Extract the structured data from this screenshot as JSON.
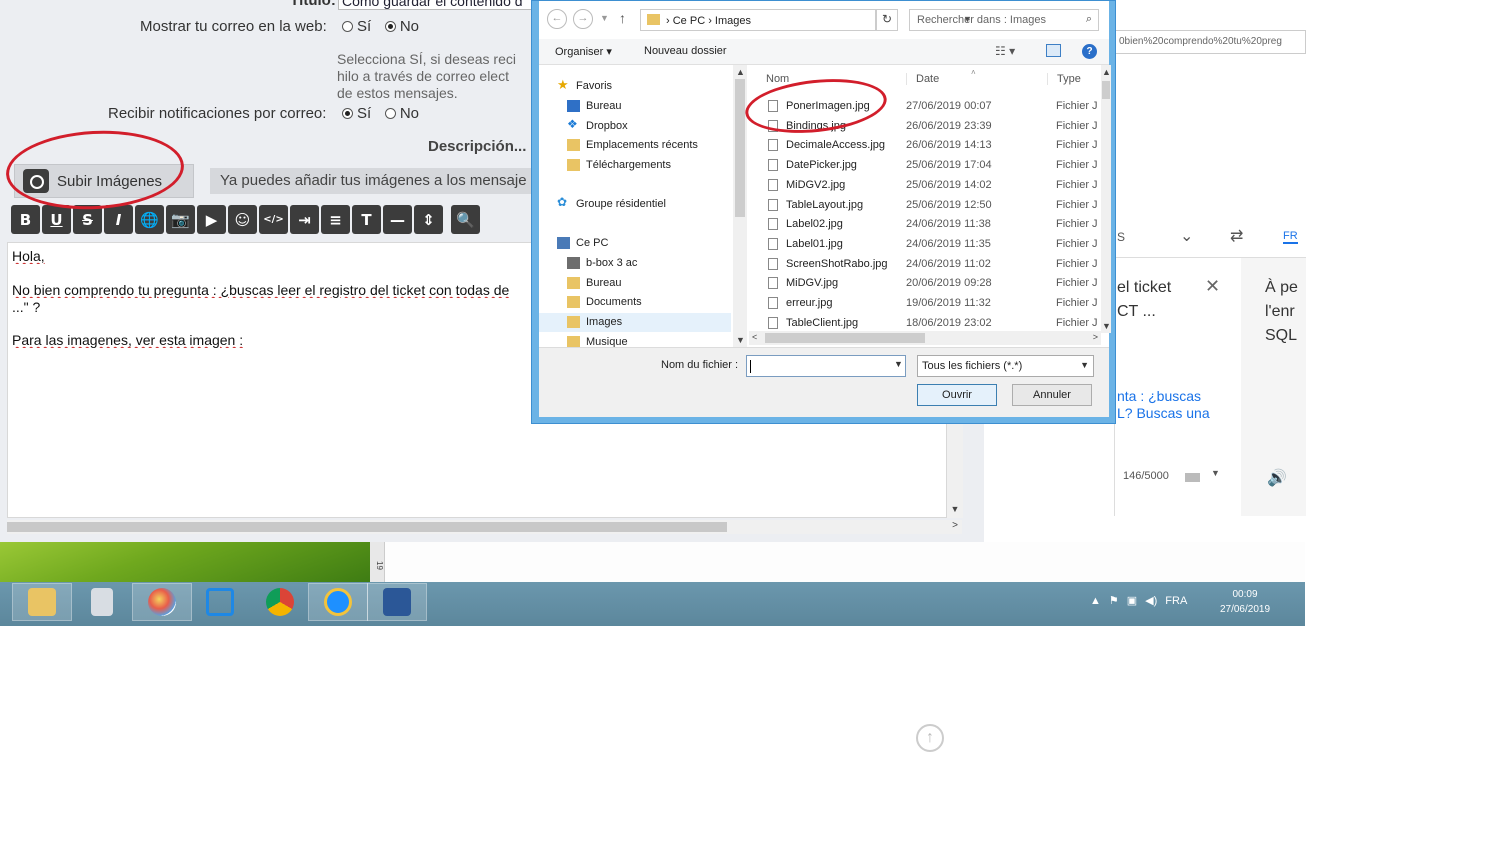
{
  "forum": {
    "titulo_label": "Título:",
    "titulo_value": "Cómo guardar el contenido d",
    "mostrar_label": "Mostrar tu correo en la web:",
    "mostrar_options": [
      "Sí",
      "No"
    ],
    "help_lines": [
      "Selecciona SÍ, si deseas reci",
      "hilo a través de correo elect",
      "de estos mensajes."
    ],
    "recibir_label": "Recibir notificaciones por correo:",
    "recibir_options": [
      "Sí",
      "No"
    ],
    "descripcion": "Descripción...",
    "upload_label": "Subir Imágenes",
    "upload_hint": "Ya puedes añadir tus imágenes a los mensaje",
    "toolbar": [
      "B",
      "U",
      "S",
      "I",
      "🌐",
      "📷",
      "▶",
      "☺",
      "</>",
      "⇥",
      "≡",
      "T",
      "—",
      "⇕",
      "🔍"
    ],
    "editor": {
      "line1": "Hola,",
      "line2": "No bien comprendo tu pregunta : ¿buscas leer el registro del ticket con todas de",
      "line3": "...\" ?",
      "line4": "Para las imagenes, ver esta imagen :"
    }
  },
  "translator": {
    "url": "0bien%20comprendo%20tu%20preg",
    "lang_src": "S",
    "lang_dst": "FR",
    "src_text_1": "el ticket",
    "src_text_2": "CT ...",
    "dst_text_1": "À pe",
    "dst_text_2": "l'enr",
    "dst_text_3": "SQL",
    "link_1": "nta : ¿buscas",
    "link_2": "L? Buscas una",
    "count": "146/5000"
  },
  "desktop": {
    "ruler": "19"
  },
  "taskbar": {
    "apps": [
      "file-explorer",
      "calculator",
      "paint",
      "snipping-tool",
      "chrome",
      "internet-explorer",
      "word"
    ],
    "lang": "FRA",
    "time": "00:09",
    "date": "27/06/2019"
  },
  "dialog": {
    "address_parts": [
      "Ce PC",
      "Images"
    ],
    "search_placeholder": "Rechercher dans : Images",
    "organiser": "Organiser",
    "nouveau_dossier": "Nouveau dossier",
    "nav_items": [
      {
        "label": "Favoris",
        "icon": "star"
      },
      {
        "label": "Bureau",
        "icon": "desktop"
      },
      {
        "label": "Dropbox",
        "icon": "dropbox"
      },
      {
        "label": "Emplacements récents",
        "icon": "folder"
      },
      {
        "label": "Téléchargements",
        "icon": "folder"
      },
      {
        "label": "Groupe résidentiel",
        "icon": "homegroup"
      },
      {
        "label": "Ce PC",
        "icon": "pc"
      },
      {
        "label": "b-box 3 ac",
        "icon": "device"
      },
      {
        "label": "Bureau",
        "icon": "folder"
      },
      {
        "label": "Documents",
        "icon": "folder"
      },
      {
        "label": "Images",
        "icon": "folder"
      },
      {
        "label": "Musique",
        "icon": "folder"
      }
    ],
    "columns": {
      "name": "Nom",
      "date": "Date",
      "type": "Type"
    },
    "files": [
      {
        "name": "PonerImagen.jpg",
        "date": "27/06/2019 00:07",
        "type": "Fichier J"
      },
      {
        "name": "Bindings.jpg",
        "date": "26/06/2019 23:39",
        "type": "Fichier J"
      },
      {
        "name": "DecimaleAccess.jpg",
        "date": "26/06/2019 14:13",
        "type": "Fichier J"
      },
      {
        "name": "DatePicker.jpg",
        "date": "25/06/2019 17:04",
        "type": "Fichier J"
      },
      {
        "name": "MiDGV2.jpg",
        "date": "25/06/2019 14:02",
        "type": "Fichier J"
      },
      {
        "name": "TableLayout.jpg",
        "date": "25/06/2019 12:50",
        "type": "Fichier J"
      },
      {
        "name": "Label02.jpg",
        "date": "24/06/2019 11:38",
        "type": "Fichier J"
      },
      {
        "name": "Label01.jpg",
        "date": "24/06/2019 11:35",
        "type": "Fichier J"
      },
      {
        "name": "ScreenShotRabo.jpg",
        "date": "24/06/2019 11:02",
        "type": "Fichier J"
      },
      {
        "name": "MiDGV.jpg",
        "date": "20/06/2019 09:28",
        "type": "Fichier J"
      },
      {
        "name": "erreur.jpg",
        "date": "19/06/2019 11:32",
        "type": "Fichier J"
      },
      {
        "name": "TableClient.jpg",
        "date": "18/06/2019 23:02",
        "type": "Fichier J"
      }
    ],
    "filename_label": "Nom du fichier :",
    "filename_value": "",
    "filter": "Tous les fichiers (*.*)",
    "open_label": "Ouvrir",
    "cancel_label": "Annuler"
  },
  "colors": {
    "annotation": "#d21e2b",
    "dialog_frame": "#6bb3e6",
    "taskbar": "#5c879c"
  }
}
